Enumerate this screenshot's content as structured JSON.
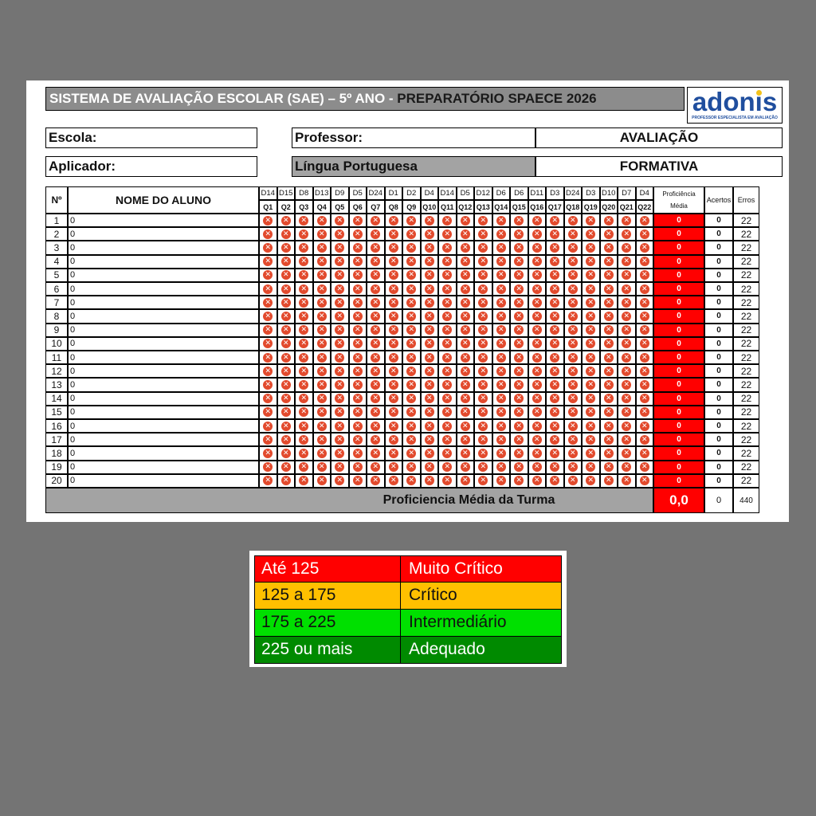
{
  "header": {
    "title_main": "SISTEMA DE AVALIAÇÃO ESCOLAR (SAE) – 5º ANO -",
    "title_tail": "PREPARATÓRIO SPAECE 2026",
    "logo_word_a": "adon",
    "logo_word_i": "i",
    "logo_word_b": "s",
    "logo_tagline": "PROFESSOR ESPECIALISTA EM AVALIAÇÃO",
    "escola_label": "Escola:",
    "professor_label": "Professor:",
    "avaliacao_label": "AVALIAÇÃO",
    "aplicador_label": "Aplicador:",
    "disciplina": "Língua Portuguesa",
    "formativa_label": "FORMATIVA"
  },
  "table": {
    "num_header": "Nº",
    "name_header": "NOME DO ALUNO",
    "descriptors": [
      "D14",
      "D15",
      "D8",
      "D13",
      "D9",
      "D5",
      "D24",
      "D1",
      "D2",
      "D4",
      "D14",
      "D5",
      "D12",
      "D6",
      "D6",
      "D11",
      "D3",
      "D24",
      "D3",
      "D10",
      "D7",
      "D4"
    ],
    "questions": [
      "Q1",
      "Q2",
      "Q3",
      "Q4",
      "Q5",
      "Q6",
      "Q7",
      "Q8",
      "Q9",
      "Q10",
      "Q11",
      "Q12",
      "Q13",
      "Q14",
      "Q15",
      "Q16",
      "Q17",
      "Q18",
      "Q19",
      "Q20",
      "Q21",
      "Q22"
    ],
    "prof_header_1": "Proficiência",
    "prof_header_2": "Média",
    "acertos_header": "Acertos",
    "erros_header": "Erros",
    "answer_icon": "x-circle-icon",
    "answer_glyph": "✕",
    "rows": [
      {
        "n": "1",
        "name": "0",
        "prof": "0",
        "acertos": "0",
        "erros": "22"
      },
      {
        "n": "2",
        "name": "0",
        "prof": "0",
        "acertos": "0",
        "erros": "22"
      },
      {
        "n": "3",
        "name": "0",
        "prof": "0",
        "acertos": "0",
        "erros": "22"
      },
      {
        "n": "4",
        "name": "0",
        "prof": "0",
        "acertos": "0",
        "erros": "22"
      },
      {
        "n": "5",
        "name": "0",
        "prof": "0",
        "acertos": "0",
        "erros": "22"
      },
      {
        "n": "6",
        "name": "0",
        "prof": "0",
        "acertos": "0",
        "erros": "22"
      },
      {
        "n": "7",
        "name": "0",
        "prof": "0",
        "acertos": "0",
        "erros": "22"
      },
      {
        "n": "8",
        "name": "0",
        "prof": "0",
        "acertos": "0",
        "erros": "22"
      },
      {
        "n": "9",
        "name": "0",
        "prof": "0",
        "acertos": "0",
        "erros": "22"
      },
      {
        "n": "10",
        "name": "0",
        "prof": "0",
        "acertos": "0",
        "erros": "22"
      },
      {
        "n": "11",
        "name": "0",
        "prof": "0",
        "acertos": "0",
        "erros": "22"
      },
      {
        "n": "12",
        "name": "0",
        "prof": "0",
        "acertos": "0",
        "erros": "22"
      },
      {
        "n": "13",
        "name": "0",
        "prof": "0",
        "acertos": "0",
        "erros": "22"
      },
      {
        "n": "14",
        "name": "0",
        "prof": "0",
        "acertos": "0",
        "erros": "22"
      },
      {
        "n": "15",
        "name": "0",
        "prof": "0",
        "acertos": "0",
        "erros": "22"
      },
      {
        "n": "16",
        "name": "0",
        "prof": "0",
        "acertos": "0",
        "erros": "22"
      },
      {
        "n": "17",
        "name": "0",
        "prof": "0",
        "acertos": "0",
        "erros": "22"
      },
      {
        "n": "18",
        "name": "0",
        "prof": "0",
        "acertos": "0",
        "erros": "22"
      },
      {
        "n": "19",
        "name": "0",
        "prof": "0",
        "acertos": "0",
        "erros": "22"
      },
      {
        "n": "20",
        "name": "0",
        "prof": "0",
        "acertos": "0",
        "erros": "22"
      }
    ],
    "footer_label": "Proficiencia Média da Turma",
    "footer_prof": "0,0",
    "footer_acertos": "0",
    "footer_erros": "440"
  },
  "colors": {
    "muito_critico": "#ff0000",
    "critico": "#ffc000",
    "intermediario": "#00e000",
    "adequado": "#008a00",
    "error_icon": "#e24a2d"
  },
  "legend": [
    {
      "range": "Até 125",
      "level": "Muito Crítico",
      "color": "#ff0000"
    },
    {
      "range": "125 a 175",
      "level": "Crítico",
      "color": "#ffc000"
    },
    {
      "range": "175 a 225",
      "level": "Intermediário",
      "color": "#00e000"
    },
    {
      "range": "225 ou mais",
      "level": "Adequado",
      "color": "#008a00"
    }
  ]
}
